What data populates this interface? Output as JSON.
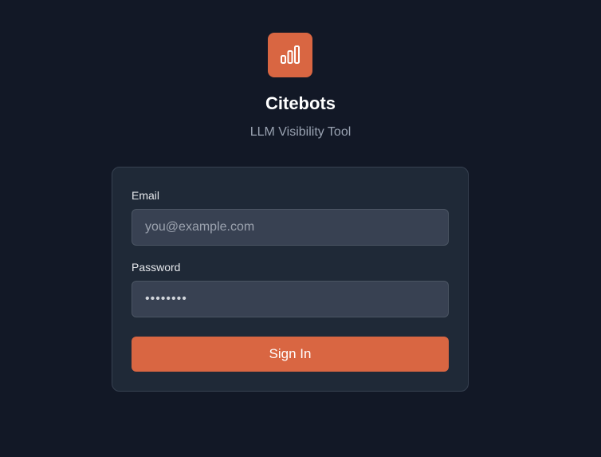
{
  "brand": {
    "logo_icon": "bar-chart-icon",
    "accent_color": "#d96642",
    "title": "Citebots",
    "subtitle": "LLM Visibility Tool"
  },
  "form": {
    "email": {
      "label": "Email",
      "placeholder": "you@example.com",
      "value": ""
    },
    "password": {
      "label": "Password",
      "value": "••••••••"
    },
    "submit_label": "Sign In"
  }
}
